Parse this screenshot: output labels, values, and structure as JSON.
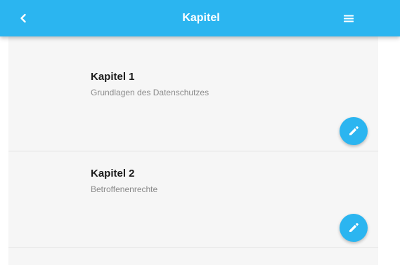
{
  "header": {
    "title": "Kapitel",
    "back_icon": "chevron-left-icon",
    "menu_icon": "hamburger-menu-icon"
  },
  "colors": {
    "accent": "#2bb5f0",
    "list_background": "#f6f6f6",
    "title_text": "#1c1c1c",
    "subtitle_text": "#8a8a8a"
  },
  "chapters": [
    {
      "title": "Kapitel 1",
      "subtitle": "Grundlagen des Datenschutzes",
      "action_icon": "pencil-icon"
    },
    {
      "title": "Kapitel 2",
      "subtitle": "Betroffenenrechte",
      "action_icon": "pencil-icon"
    }
  ]
}
